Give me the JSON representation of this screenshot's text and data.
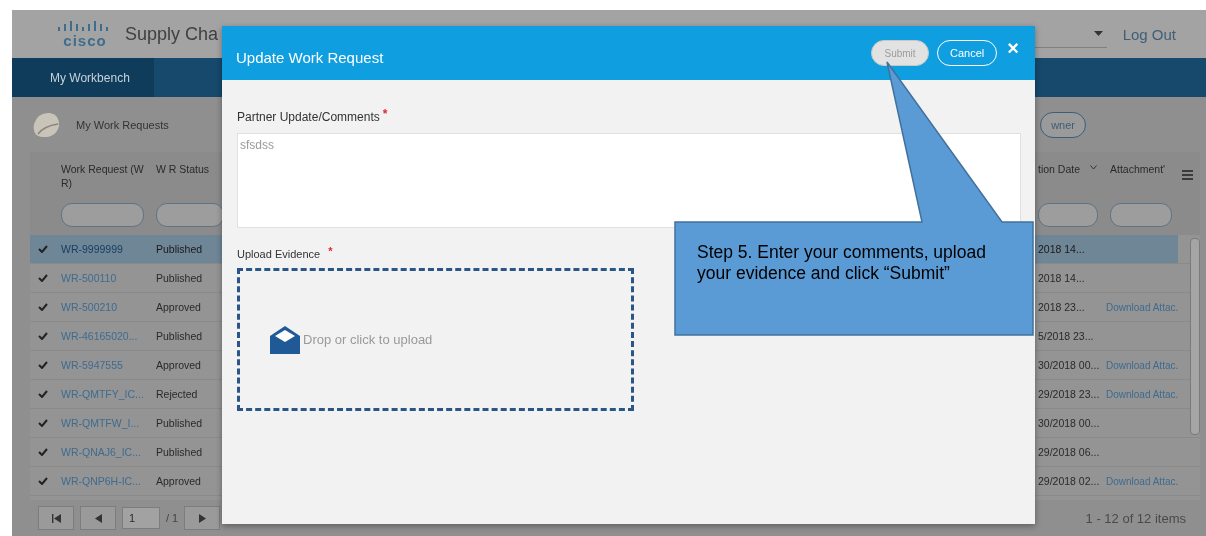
{
  "app": {
    "logo": "cisco",
    "title": "Supply Cha",
    "logout": "Log Out",
    "nav_tabs": [
      {
        "label": "My Workbench",
        "selected": true
      }
    ],
    "page_title": "My Work Requests",
    "owner_button": "wner"
  },
  "table": {
    "columns": [
      "Work Request (W R)",
      "W R Status",
      "tion Date",
      "Attachment'"
    ],
    "rows": [
      {
        "checked": true,
        "selected": true,
        "work_request": "WR-9999999",
        "status": "Published",
        "date": "2018 14..."
      },
      {
        "checked": true,
        "selected": false,
        "work_request": "WR-500110",
        "status": "Published",
        "date": "2018 14..."
      },
      {
        "checked": true,
        "selected": false,
        "work_request": "WR-500210",
        "status": "Approved",
        "date": "2018 23...",
        "attachment": "Download Attac."
      },
      {
        "checked": true,
        "selected": false,
        "work_request": "WR-46165020...",
        "status": "Published",
        "date": "5/2018 23..."
      },
      {
        "checked": true,
        "selected": false,
        "work_request": "WR-5947555",
        "status": "Approved",
        "date": "30/2018 00...",
        "attachment": "Download Attac."
      },
      {
        "checked": true,
        "selected": false,
        "work_request": "WR-QMTFY_IC...",
        "status": "Rejected",
        "date": "29/2018 23...",
        "attachment": "Download Attac."
      },
      {
        "checked": true,
        "selected": false,
        "work_request": "WR-QMTFW_I...",
        "status": "Published",
        "date": "30/2018 00..."
      },
      {
        "checked": true,
        "selected": false,
        "work_request": "WR-QNAJ6_IC...",
        "status": "Published",
        "date": "29/2018 06..."
      },
      {
        "checked": true,
        "selected": false,
        "work_request": "WR-QNP6H-IC...",
        "status": "Approved",
        "date": "29/2018 02...",
        "attachment": "Download Attac."
      }
    ],
    "pager": {
      "page": "1",
      "of": "/ 1",
      "summary": "1 - 12 of 12 items"
    }
  },
  "modal": {
    "title": "Update Work Request",
    "submit": {
      "label": "Submit",
      "disabled": true
    },
    "cancel": "Cancel",
    "close": "×",
    "comments": {
      "label": "Partner Update/Comments",
      "mark": "*",
      "value": "sfsdss"
    },
    "upload": {
      "label": "Upload Evidence",
      "mark": "*",
      "hint": "Drop or click to upload"
    }
  },
  "callout": {
    "text": "Step 5. Enter your comments, upload your evidence and click “Submit”"
  }
}
